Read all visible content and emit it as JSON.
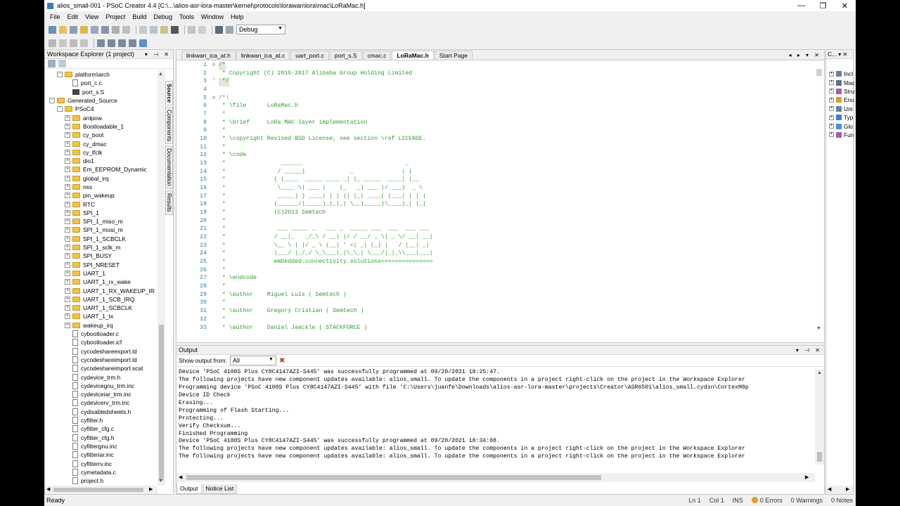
{
  "window": {
    "title": "alios_small-001 - PSoC Creator 4.4  [C:\\...\\alios-asr-lora-master\\kernel\\protocols\\lorawan\\lora\\mac\\LoRaMac.h]",
    "minimize": "—",
    "restore": "❐",
    "close": "✕"
  },
  "menu": [
    "File",
    "Edit",
    "View",
    "Project",
    "Build",
    "Debug",
    "Tools",
    "Window",
    "Help"
  ],
  "toolbar": {
    "config_value": "Debug"
  },
  "workspace": {
    "title": "Workspace Explorer (1 project)",
    "side_tabs": [
      "Source",
      "Components",
      "Documentation",
      "Results"
    ],
    "tree": [
      {
        "label": "platform\\arch",
        "indent": 2,
        "type": "folder",
        "exp": "-"
      },
      {
        "label": "port_c.c",
        "indent": 3,
        "type": "file"
      },
      {
        "label": "port_s.S",
        "indent": 3,
        "type": "asm"
      },
      {
        "label": "Generated_Source",
        "indent": 1,
        "type": "folder",
        "exp": "-"
      },
      {
        "label": "PSoC4",
        "indent": 2,
        "type": "folder",
        "exp": "-"
      },
      {
        "label": "antpow",
        "indent": 3,
        "type": "folder",
        "exp": "+"
      },
      {
        "label": "Bootloadable_1",
        "indent": 3,
        "type": "folder",
        "exp": "+"
      },
      {
        "label": "cy_boot",
        "indent": 3,
        "type": "folder",
        "exp": "+"
      },
      {
        "label": "cy_dmac",
        "indent": 3,
        "type": "folder",
        "exp": "+"
      },
      {
        "label": "cy_lfclk",
        "indent": 3,
        "type": "folder",
        "exp": "+"
      },
      {
        "label": "dio1",
        "indent": 3,
        "type": "folder",
        "exp": "+"
      },
      {
        "label": "Em_EEPROM_Dynamic",
        "indent": 3,
        "type": "folder",
        "exp": "+"
      },
      {
        "label": "global_irq",
        "indent": 3,
        "type": "folder",
        "exp": "+"
      },
      {
        "label": "nss",
        "indent": 3,
        "type": "folder",
        "exp": "+"
      },
      {
        "label": "pin_wakeup",
        "indent": 3,
        "type": "folder",
        "exp": "+"
      },
      {
        "label": "RTC",
        "indent": 3,
        "type": "folder",
        "exp": "+"
      },
      {
        "label": "SPI_1",
        "indent": 3,
        "type": "folder",
        "exp": "+"
      },
      {
        "label": "SPI_1_miso_m",
        "indent": 3,
        "type": "folder",
        "exp": "+"
      },
      {
        "label": "SPI_1_mosi_m",
        "indent": 3,
        "type": "folder",
        "exp": "+"
      },
      {
        "label": "SPI_1_SCBCLK",
        "indent": 3,
        "type": "folder",
        "exp": "+"
      },
      {
        "label": "SPI_1_sclk_m",
        "indent": 3,
        "type": "folder",
        "exp": "+"
      },
      {
        "label": "SPI_BUSY",
        "indent": 3,
        "type": "folder",
        "exp": "+"
      },
      {
        "label": "SPI_NRESET",
        "indent": 3,
        "type": "folder",
        "exp": "+"
      },
      {
        "label": "UART_1",
        "indent": 3,
        "type": "folder",
        "exp": "+"
      },
      {
        "label": "UART_1_rx_wake",
        "indent": 3,
        "type": "folder",
        "exp": "+"
      },
      {
        "label": "UART_1_RX_WAKEUP_IR",
        "indent": 3,
        "type": "folder",
        "exp": "+"
      },
      {
        "label": "UART_1_SCB_IRQ",
        "indent": 3,
        "type": "folder",
        "exp": "+"
      },
      {
        "label": "UART_1_SCBCLK",
        "indent": 3,
        "type": "folder",
        "exp": "+"
      },
      {
        "label": "UART_1_tx",
        "indent": 3,
        "type": "folder",
        "exp": "+"
      },
      {
        "label": "wakeup_irq",
        "indent": 3,
        "type": "folder",
        "exp": "+"
      },
      {
        "label": "cybootloader.c",
        "indent": 3,
        "type": "file"
      },
      {
        "label": "cybootloader.icf",
        "indent": 3,
        "type": "file"
      },
      {
        "label": "cycodeshareexport.ld",
        "indent": 3,
        "type": "file"
      },
      {
        "label": "cycodeshareimport.ld",
        "indent": 3,
        "type": "file"
      },
      {
        "label": "cycodeshareimport.scat",
        "indent": 3,
        "type": "file"
      },
      {
        "label": "cydevice_trm.h",
        "indent": 3,
        "type": "file"
      },
      {
        "label": "cydevicegnu_trm.inc",
        "indent": 3,
        "type": "file"
      },
      {
        "label": "cydeviceiar_trm.inc",
        "indent": 3,
        "type": "file"
      },
      {
        "label": "cydevicerv_trm.inc",
        "indent": 3,
        "type": "file"
      },
      {
        "label": "cydisabledsheets.h",
        "indent": 3,
        "type": "file"
      },
      {
        "label": "cyfitter.h",
        "indent": 3,
        "type": "file"
      },
      {
        "label": "cyfitter_cfg.c",
        "indent": 3,
        "type": "file"
      },
      {
        "label": "cyfitter_cfg.h",
        "indent": 3,
        "type": "file"
      },
      {
        "label": "cyfittergnu.inc",
        "indent": 3,
        "type": "file"
      },
      {
        "label": "cyfitteriar.inc",
        "indent": 3,
        "type": "file"
      },
      {
        "label": "cyfitterrv.inc",
        "indent": 3,
        "type": "file"
      },
      {
        "label": "cymetadata.c",
        "indent": 3,
        "type": "file"
      },
      {
        "label": "project.h",
        "indent": 3,
        "type": "file"
      }
    ]
  },
  "editor": {
    "tabs": [
      "linkwan_ica_at.h",
      "linkwan_ica_at.c",
      "uart_port.c",
      "port_s.S",
      "cmac.c",
      "LoRaMac.h",
      "Start Page"
    ],
    "active_tab": "LoRaMac.h",
    "lines": [
      {
        "n": "1",
        "fold": "-",
        "t": "/*",
        "sel": true
      },
      {
        "n": "2",
        "fold": "",
        "t": " * Copyright (C) 2015-2017 Alibaba Group Holding Limited",
        "sel": false
      },
      {
        "n": "3",
        "fold": "L",
        "t": " */",
        "sel": true
      },
      {
        "n": "4",
        "fold": "",
        "t": "",
        "sel": false
      },
      {
        "n": "5",
        "fold": "-",
        "t": "/*!",
        "sel": false
      },
      {
        "n": "6",
        "fold": "",
        "t": " * \\file      LoRaMac.h",
        "sel": false
      },
      {
        "n": "7",
        "fold": "",
        "t": " *",
        "sel": false
      },
      {
        "n": "8",
        "fold": "",
        "t": " * \\brief     LoRa MAC layer implementation",
        "sel": false
      },
      {
        "n": "9",
        "fold": "",
        "t": " *",
        "sel": false
      },
      {
        "n": "10",
        "fold": "",
        "t": " * \\copyright Revised BSD License, see section \\ref LICENSE.",
        "sel": false
      },
      {
        "n": "11",
        "fold": "",
        "t": " *",
        "sel": false
      },
      {
        "n": "12",
        "fold": "",
        "t": " * \\code",
        "sel": false
      },
      {
        "n": "13",
        "fold": "",
        "t": " *                ______                              _",
        "sel": false
      },
      {
        "n": "14",
        "fold": "",
        "t": " *               / _____)             _              | |",
        "sel": false
      },
      {
        "n": "15",
        "fold": "",
        "t": " *              ( (____  _____ ____ _| |_ _____  ____| |__",
        "sel": false
      },
      {
        "n": "16",
        "fold": "",
        "t": " *               \\____ \\| ___ |    (_   _) ___ |/ ___)  _ \\",
        "sel": false
      },
      {
        "n": "17",
        "fold": "",
        "t": " *               _____) ) ____| | | || |_| ____( (___| | | |",
        "sel": false
      },
      {
        "n": "18",
        "fold": "",
        "t": " *              (______/|_____)_|_|_| \\__)_____)\\____)_| |_|",
        "sel": false
      },
      {
        "n": "19",
        "fold": "",
        "t": " *              (C)2013 Semtech",
        "sel": false
      },
      {
        "n": "20",
        "fold": "",
        "t": " *",
        "sel": false
      },
      {
        "n": "21",
        "fold": "",
        "t": " *               ___ _____ _   ___ _  _____ ___  ___  ___ ___",
        "sel": false
      },
      {
        "n": "22",
        "fold": "",
        "t": " *              / __|_   _/_\\ / __| |/ / __/ _ \\| _ \\/ __| __|",
        "sel": false
      },
      {
        "n": "23",
        "fold": "",
        "t": " *              \\__ \\ | |/ _ \\ (__| ' <| _| (_) |   / (__| _|",
        "sel": false
      },
      {
        "n": "24",
        "fold": "",
        "t": " *              |___/ |_/_/ \\_\\___|_|\\_\\_| \\___/|_|_\\\\___|___|",
        "sel": false
      },
      {
        "n": "25",
        "fold": "",
        "t": " *              embedded.connectivity.solutions===============",
        "sel": false
      },
      {
        "n": "26",
        "fold": "",
        "t": " *",
        "sel": false
      },
      {
        "n": "27",
        "fold": "",
        "t": " * \\endcode",
        "sel": false
      },
      {
        "n": "28",
        "fold": "",
        "t": " *",
        "sel": false
      },
      {
        "n": "29",
        "fold": "",
        "t": " * \\author    Miguel Luis ( Semtech )",
        "sel": false
      },
      {
        "n": "30",
        "fold": "",
        "t": " *",
        "sel": false
      },
      {
        "n": "31",
        "fold": "",
        "t": " * \\author    Gregory Cristian ( Semtech )",
        "sel": false
      },
      {
        "n": "32",
        "fold": "",
        "t": " *",
        "sel": false
      },
      {
        "n": "33",
        "fold": "",
        "t": " * \\author    Daniel Jaeckle ( STACKFORCE )",
        "sel": false
      }
    ]
  },
  "output": {
    "title": "Output",
    "filter_label": "Show output from:",
    "filter_value": "All",
    "lines": [
      "Device 'PSoC 4100S Plus CY8C4147AZI-S445' was successfully programmed at 09/20/2021 18:25:47.",
      "The following projects have new component updates available: alios_small. To update the components in a project right-click on the project in the Workspace Explorer",
      "Programming device 'PSoC 4100S Plus CY8C4147AZI-S445' with file 'C:\\Users\\juanfe\\Downloads\\alios-asr-lora-master\\projects\\Creator\\ASR6501\\alios_small.cydsn\\CortexM0p",
      "Device ID Check",
      "Erasing...",
      "Programming of Flash Starting...",
      "Protecting...",
      "Verify Checksum...",
      "Finished Programming",
      "Device 'PSoC 4100S Plus CY8C4147AZI-S445' was successfully programmed at 09/20/2021 18:34:08.",
      "The following projects have new component updates available: alios_small. To update the components in a project right-click on the project in the Workspace Explorer",
      "The following projects have new component updates available: alios_small. To update the components in a project right-click on the project in the Workspace Explorer"
    ],
    "tabs": [
      "Output",
      "Notice List"
    ]
  },
  "right_panel": {
    "title": "C...",
    "items": [
      {
        "label": "Incl",
        "color": "#6a7f9e"
      },
      {
        "label": "Mac",
        "color": "#5a6f8e"
      },
      {
        "label": "Stru",
        "color": "#a35bb5"
      },
      {
        "label": "Enu",
        "color": "#d6a02b"
      },
      {
        "label": "Uni",
        "color": "#6a7f9e"
      },
      {
        "label": "Typ",
        "color": "#3f7fc4"
      },
      {
        "label": "Glo",
        "color": "#4a8fd6"
      },
      {
        "label": "Fun",
        "color": "#a35bb5"
      }
    ]
  },
  "status": {
    "ready": "Ready",
    "ln": "Ln 1",
    "col": "Col 1",
    "ins": "INS",
    "errors": "0 Errors",
    "warnings": "0 Warnings",
    "notes": "0 Notes"
  }
}
